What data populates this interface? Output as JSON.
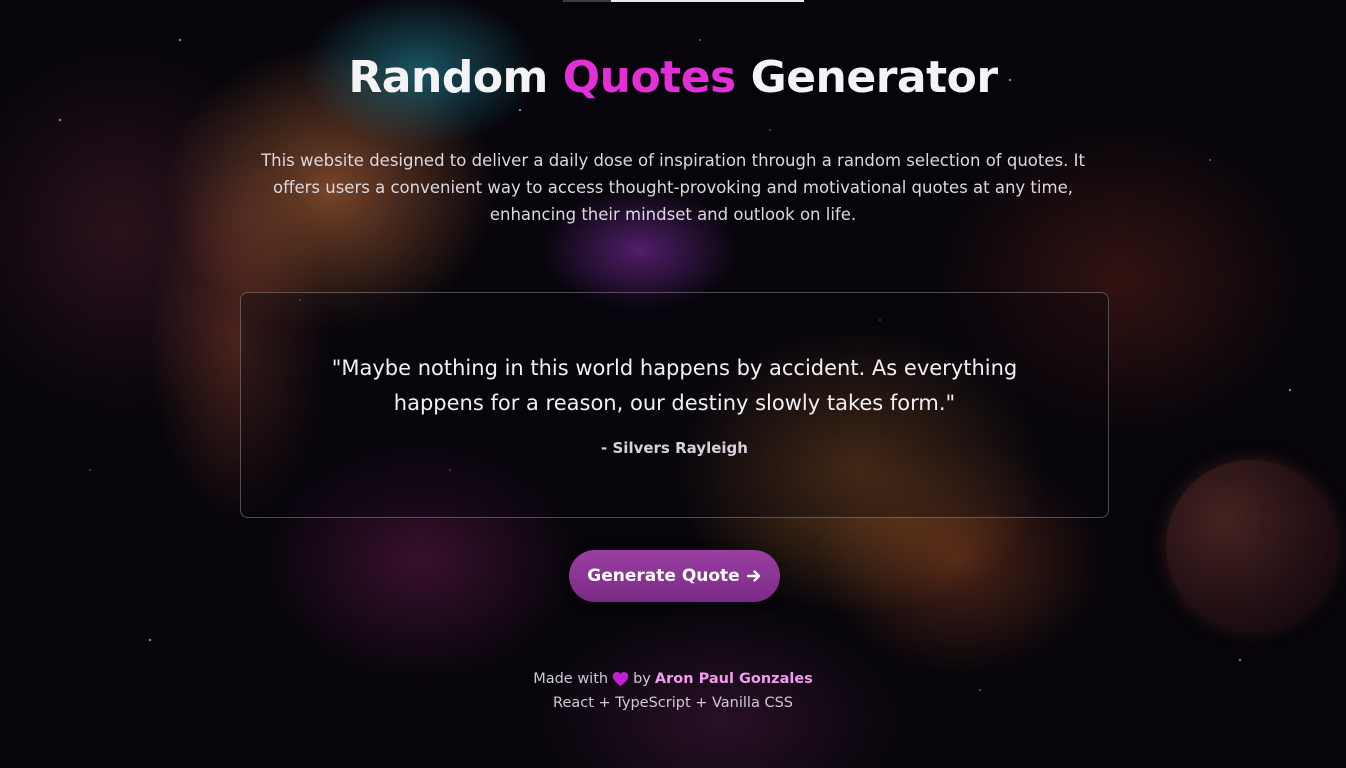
{
  "header": {
    "title_part1": "Random",
    "title_accent": "Quotes",
    "title_part2": "Generator",
    "description": "This website designed to deliver a daily dose of inspiration through a random selection of quotes. It offers users a convenient way to access thought-provoking and motivational quotes at any time, enhancing their mindset and outlook on life."
  },
  "quote": {
    "text": "\"Maybe nothing in this world happens by accident. As everything happens for a reason, our destiny slowly takes form.\"",
    "author": "- Silvers Rayleigh"
  },
  "actions": {
    "generate_label": "Generate Quote",
    "generate_icon": "arrow-right-icon"
  },
  "footer": {
    "made_with": "Made with",
    "heart_icon": "heart-icon",
    "by": "by",
    "author_name": "Aron Paul Gonzales",
    "tech_stack": "React + TypeScript + Vanilla CSS"
  },
  "colors": {
    "accent": "#e22fd6",
    "button": "#8a3494",
    "author_link": "#f19cf0",
    "background": "#07050b"
  }
}
